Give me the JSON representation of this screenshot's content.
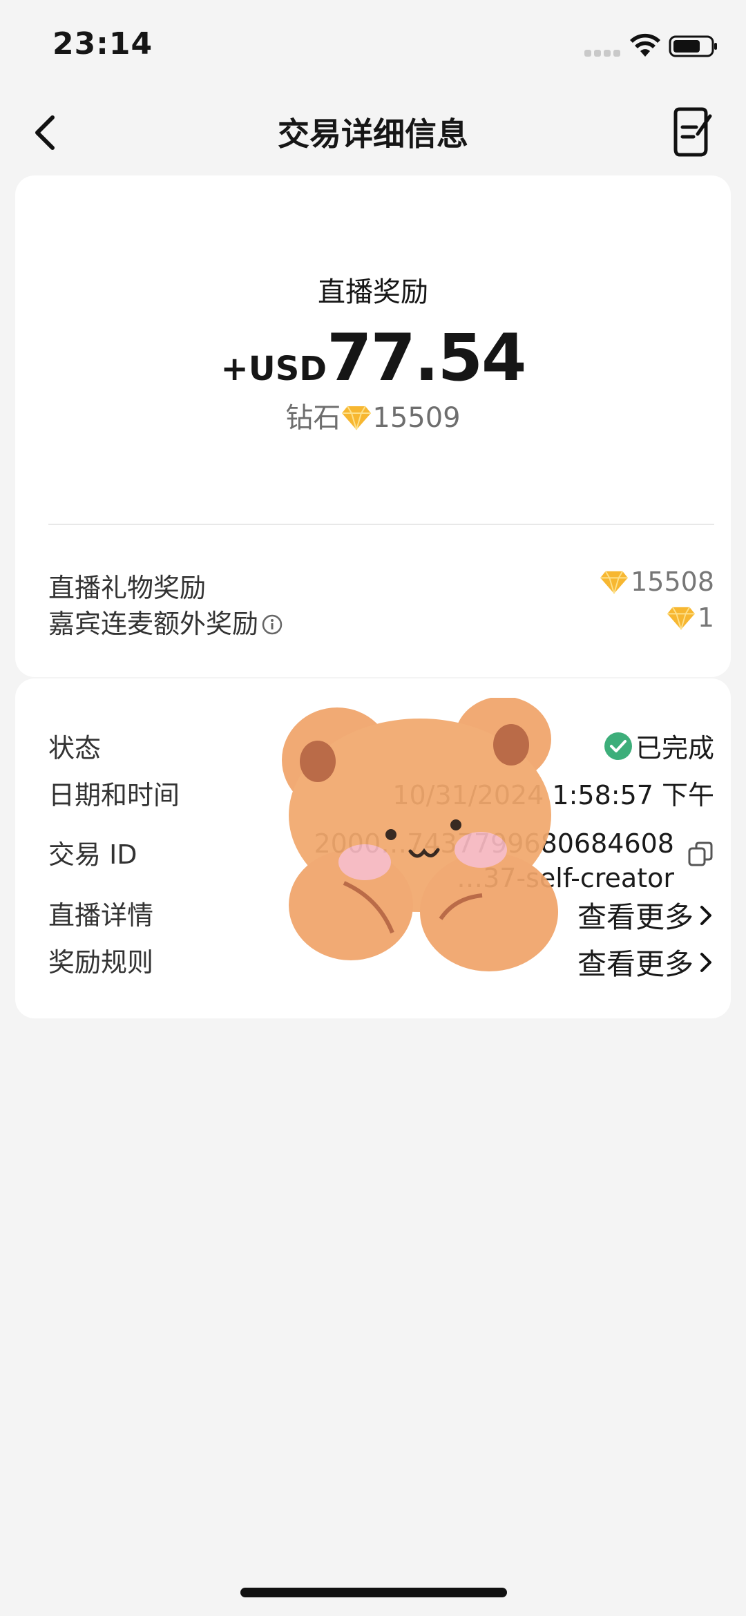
{
  "status_bar": {
    "time": "23:14"
  },
  "nav": {
    "title": "交易详细信息"
  },
  "summary": {
    "type_label": "直播奖励",
    "amount_prefix": "+USD",
    "amount_value": "77.54",
    "diamond_label": "钻石",
    "diamond_value": "15509"
  },
  "breakdown": [
    {
      "label": "直播礼物奖励",
      "value": "15508"
    },
    {
      "label": "嘉宾连麦额外奖励",
      "value": "1"
    }
  ],
  "details": {
    "status_label": "状态",
    "status_value": "已完成",
    "datetime_label": "日期和时间",
    "datetime_value": "10/31/2024 1:58:57 下午",
    "txid_label": "交易 ID",
    "txid_line1": "2000…7437799680684608",
    "txid_line2": "…37-self-creator",
    "live_label": "直播详情",
    "live_link": "查看更多",
    "rules_label": "奖励规则",
    "rules_link": "查看更多"
  },
  "colors": {
    "success": "#3dae7a",
    "diamond": "#f7b731",
    "background": "#f4f4f4"
  },
  "icons": [
    "back-icon",
    "note-icon",
    "diamond-icon",
    "info-icon",
    "check-circle-icon",
    "copy-icon",
    "chevron-right-icon",
    "wifi-icon",
    "battery-icon"
  ]
}
